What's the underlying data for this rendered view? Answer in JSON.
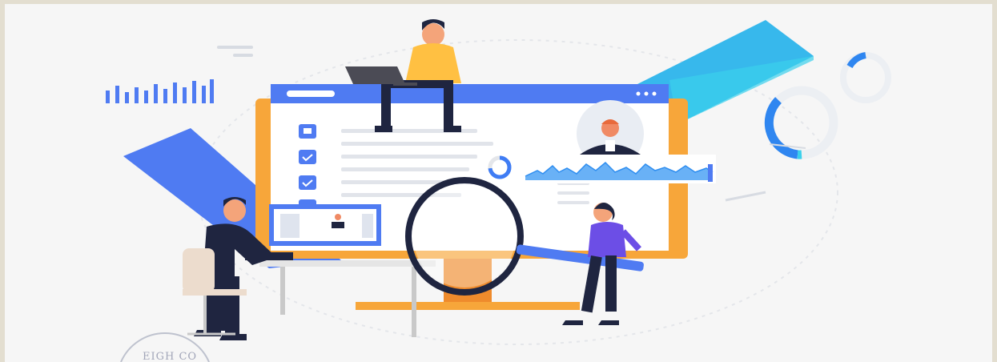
{
  "illustration": {
    "description_label": "",
    "seal_text": "EIGH CO"
  },
  "colors": {
    "background": "#f6f6f6",
    "border": "#e3ded0",
    "blue": "#3f7cf4",
    "cyan": "#35c3e8",
    "orange": "#f7a63a",
    "navy": "#1f2540",
    "purple": "#6c4ee6",
    "yellow": "#ffc042"
  },
  "icons": [
    "bar-chart-icon",
    "checkbox-icon",
    "avatar-icon",
    "magnifying-glass-icon",
    "donut-chart-icon",
    "line-chart-icon"
  ]
}
